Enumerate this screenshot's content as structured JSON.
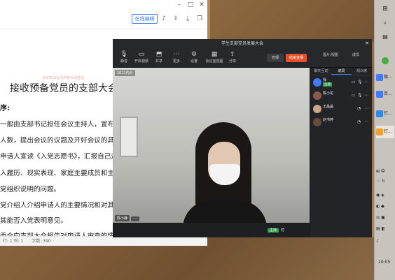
{
  "document": {
    "toolbar": {
      "online_edit": "在线编辑"
    },
    "watermark": "本资料由会员网络资源整理",
    "title": "接收预备党员的支部大会",
    "head": "序:",
    "lines": [
      "一般由支部书记担任会议主持人，宣布开",
      "人数，提出会议的议题及开好会议的具体",
      "申请人宣读《入党志愿书》，汇报自己对",
      "入履历、现实表现、家庭主要成员和主要",
      "党组织说明的问题。",
      "党介绍人介绍申请人的主要情况和对其",
      "其能否入党表明意见。",
      "委会向支部大会报告对申请人审查的情"
    ],
    "statusbar": {
      "position": "行: 1  列: 1",
      "word_count": "字数: 390"
    }
  },
  "meeting": {
    "title": "学生支部党员发展大会",
    "toolbar": [
      {
        "icon": "mic-icon",
        "label": "静音"
      },
      {
        "icon": "camera-icon",
        "label": "开启视频"
      },
      {
        "icon": "share-icon",
        "label": "共享"
      },
      {
        "icon": "more-icon",
        "label": "更多"
      },
      {
        "icon": "settings-icon",
        "label": "设置"
      },
      {
        "icon": "layout-icon",
        "label": "会议室视图"
      },
      {
        "icon": "export-icon",
        "label": "分享"
      }
    ],
    "manage_label": "管理",
    "end_label": "结束直播",
    "right_tools": [
      {
        "label": "图片/视图"
      },
      {
        "label": "成员"
      }
    ],
    "video_label": "2021内外",
    "name_tag": "陈小静",
    "self_name": "付",
    "self_role": "主持",
    "side_tabs": [
      "聊天互动",
      "成员",
      "观众席"
    ],
    "members": [
      {
        "name": "我",
        "role": "主持",
        "color": "#3f7cf5"
      },
      {
        "name": "陈小花",
        "role": "",
        "color": "#8a5a4a"
      },
      {
        "name": "王晶晶",
        "role": "",
        "color": "#c9a58b"
      },
      {
        "name": "赵书婷",
        "role": "",
        "color": "#6a4a3a"
      }
    ]
  },
  "taskbar": {
    "items": [
      "微...",
      "百...",
      "钉...",
      "钉..."
    ],
    "tray": [
      "中",
      "♪"
    ],
    "clock": "10:05"
  }
}
